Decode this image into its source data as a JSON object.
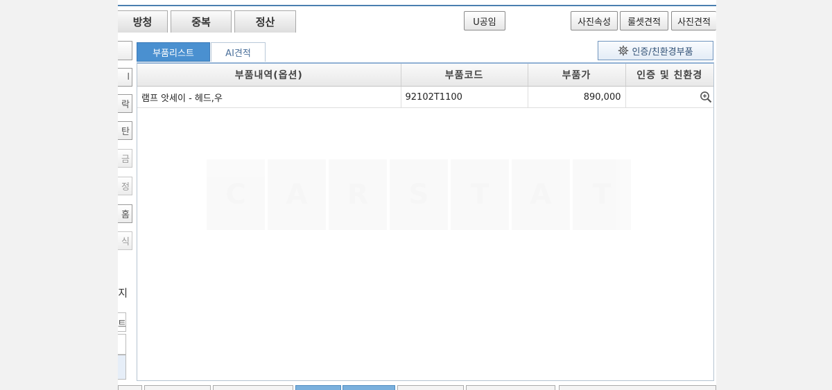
{
  "top_tabs": [
    "방청",
    "중복",
    "정산"
  ],
  "top_buttons": {
    "u_part": "U공임",
    "photo_props": "사진속성",
    "rule_set": "룰셋견적",
    "photo_estimate": "사진견적"
  },
  "side_buttons": [
    "",
    "l",
    "락",
    "탄",
    "금",
    "정",
    "홈",
    "식"
  ],
  "side_label": "지",
  "side_box_text": "트",
  "subtabs": {
    "parts_list": "부품리스트",
    "ai_estimate": "AI견적"
  },
  "cert_button": {
    "label": "인증/친환경부품",
    "icon": "gear-icon"
  },
  "table": {
    "headers": [
      "부품내역(옵션)",
      "부품코드",
      "부품가",
      "인증 및 친환경"
    ],
    "rows": [
      {
        "desc": "램프 앗세이 - 헤드,우",
        "code": "92102T1100",
        "price": "890,000",
        "icon": "zoom-in-icon"
      }
    ]
  },
  "watermark": [
    "C",
    "A",
    "R",
    "S",
    "T",
    "A",
    "T"
  ],
  "colors": {
    "accent": "#4a90d0",
    "border": "#8fb0d4"
  }
}
